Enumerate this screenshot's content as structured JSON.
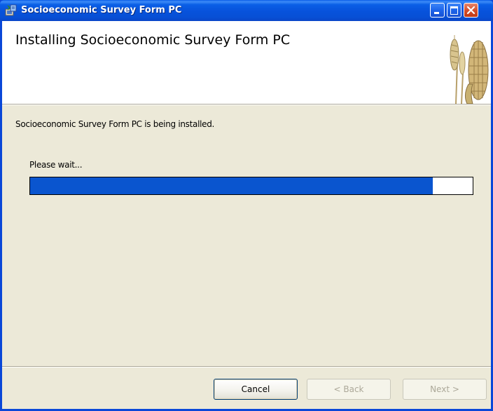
{
  "window": {
    "title": "Socioeconomic Survey Form PC"
  },
  "titlebar": {
    "icons": {
      "app": "installer-icon",
      "minimize": "minimize-icon",
      "maximize": "maximize-icon",
      "close": "close-icon"
    }
  },
  "banner": {
    "heading": "Installing Socioeconomic Survey Form PC",
    "art": "wheat-corn-image"
  },
  "content": {
    "status": "Socioeconomic Survey Form PC is being installed.",
    "wait_label": "Please wait...",
    "progress_fraction": 0.91
  },
  "buttons": {
    "cancel": "Cancel",
    "back": "< Back",
    "next": "Next >"
  },
  "colors": {
    "titlebar_blue": "#0752db",
    "progress_blue": "#0a55cf",
    "dialog_bg": "#ece9d8",
    "close_red": "#d6502c"
  }
}
